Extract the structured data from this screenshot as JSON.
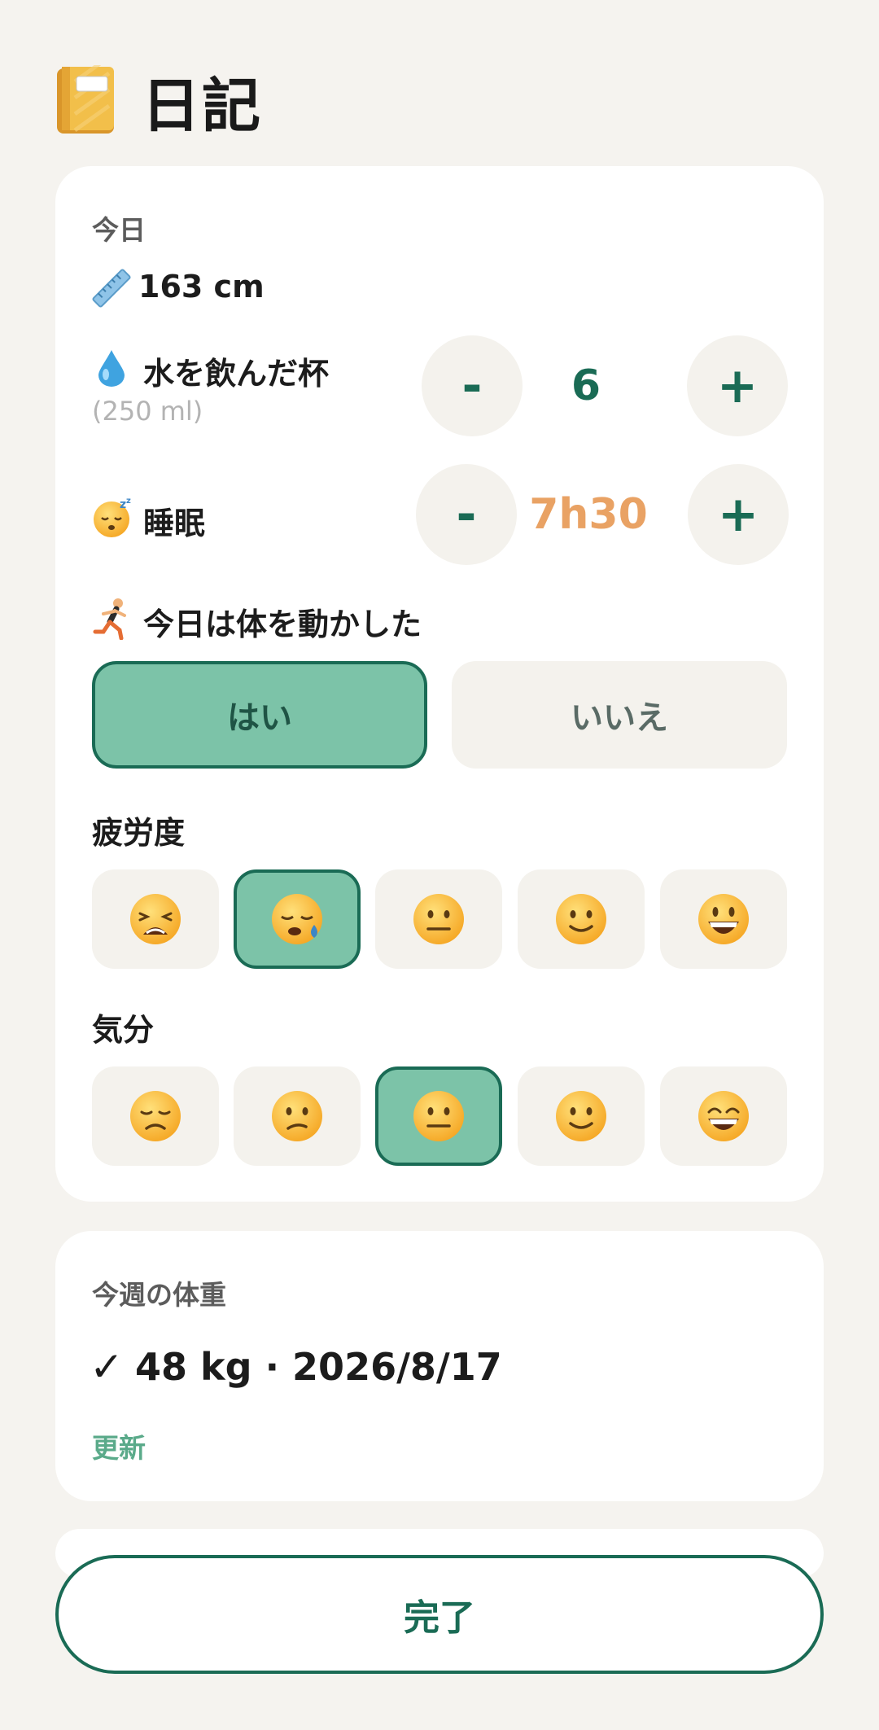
{
  "app": {
    "title": "日記",
    "title_icon": "notebook-icon"
  },
  "today": {
    "section_label": "今日",
    "height": {
      "icon": "ruler-icon",
      "value": "163 cm"
    },
    "water": {
      "icon": "droplet-icon",
      "label": "水を飲んだ杯",
      "sublabel": "(250 ml)",
      "minus_label": "-",
      "value": "6",
      "plus_label": "+",
      "value_color": "#1a6b55"
    },
    "sleep": {
      "icon": "sleeping-face-icon",
      "label": "睡眠",
      "minus_label": "-",
      "value": "7h30",
      "plus_label": "+",
      "value_color": "#e9a264"
    },
    "exercise": {
      "icon": "runner-icon",
      "label": "今日は体を動かした",
      "yes_label": "はい",
      "no_label": "いいえ",
      "selected": "yes"
    },
    "fatigue": {
      "label": "疲労度",
      "options": [
        "weary-face-icon",
        "sleepy-face-icon",
        "neutral-face-icon",
        "slightly-smiling-face-icon",
        "grinning-face-icon"
      ],
      "selected_index": 1
    },
    "mood": {
      "label": "気分",
      "options": [
        "disappointed-face-icon",
        "confused-face-icon",
        "neutral-face-icon",
        "slightly-smiling-face-icon",
        "beaming-face-icon"
      ],
      "selected_index": 2
    }
  },
  "weight": {
    "section_label": "今週の体重",
    "checkmark": "✓",
    "value": "48 kg · 2026/8/17",
    "update_label": "更新"
  },
  "footer": {
    "done_label": "完了"
  },
  "colors": {
    "accent": "#1a6b55",
    "selected_fill": "#7cc3a8",
    "sleep_value": "#e9a264",
    "background": "#f5f3ef"
  }
}
